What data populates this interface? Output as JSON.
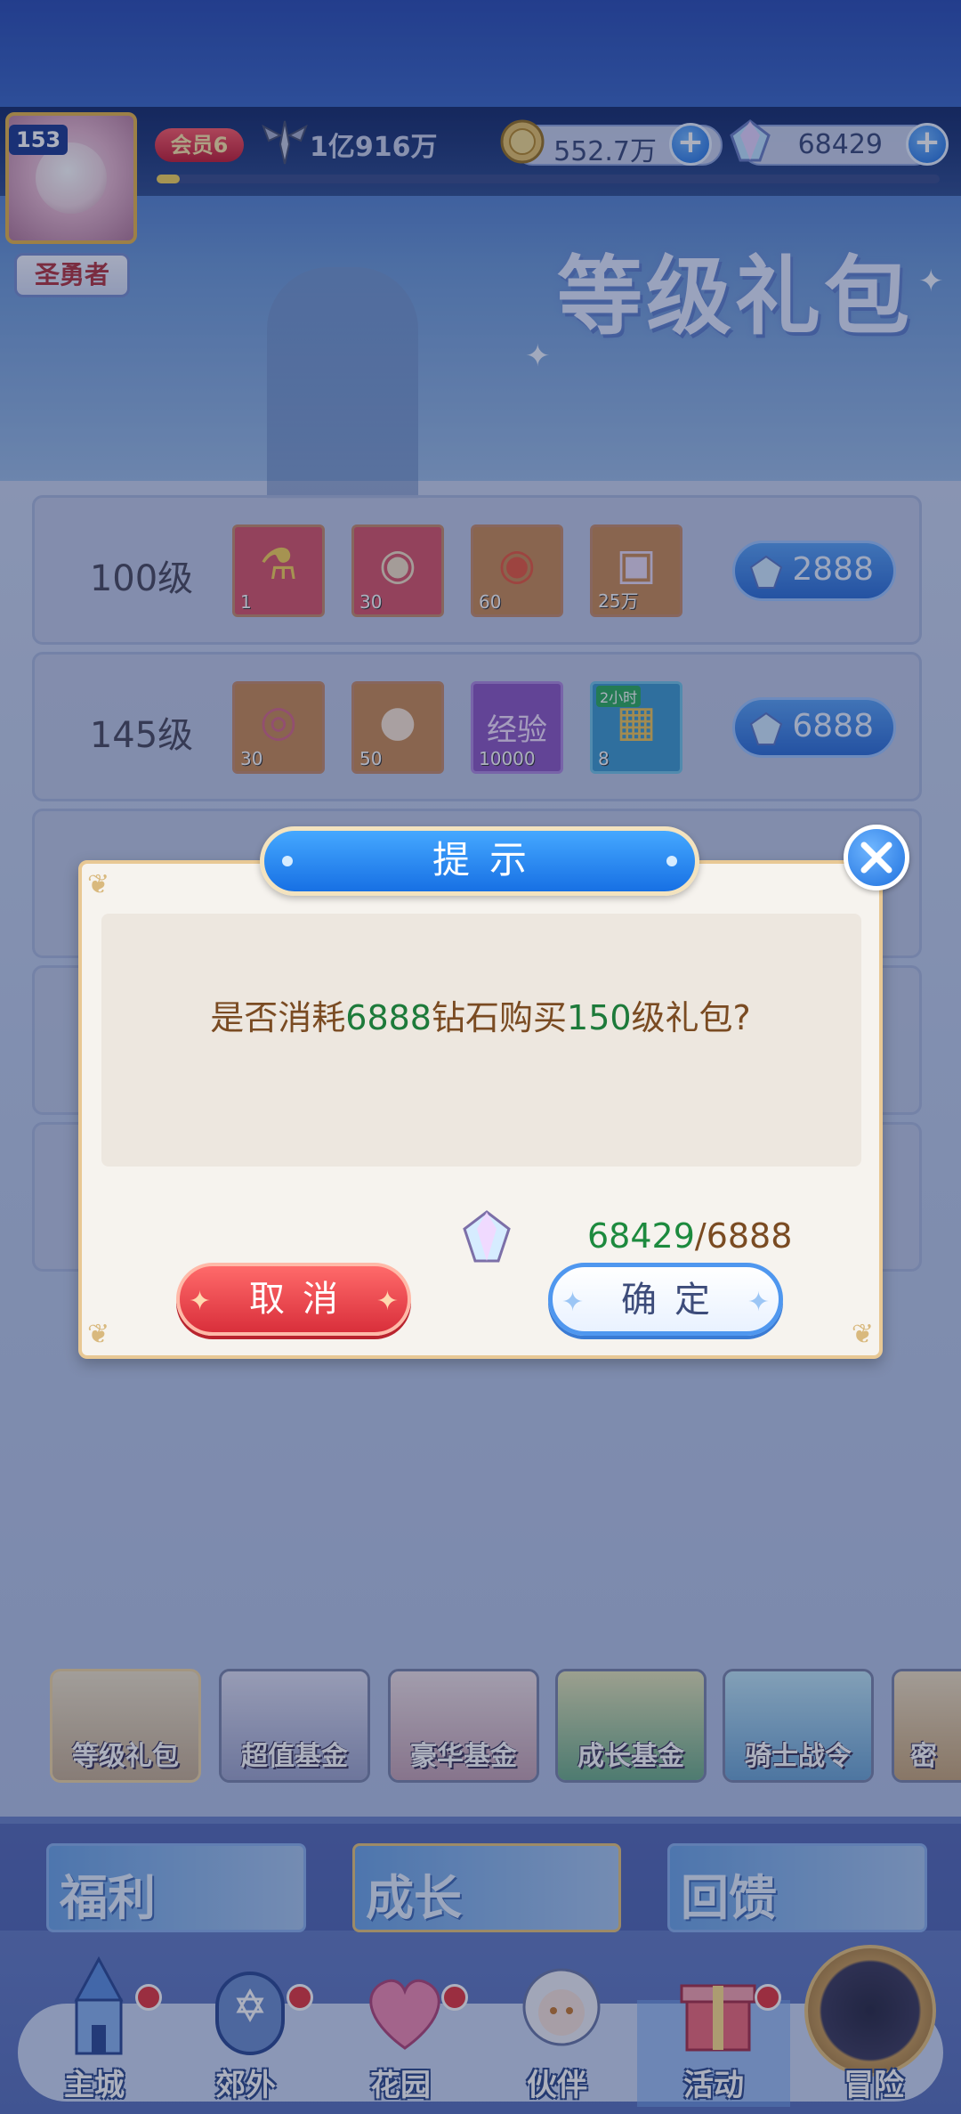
{
  "header": {
    "player_level": "153",
    "player_title": "圣勇者",
    "vip_label": "会员6",
    "power_value": "1亿916万",
    "gold_value": "552.7万",
    "diamond_value": "68429",
    "exp_progress": 0.03
  },
  "banner": {
    "title": "等级礼包"
  },
  "gift_rows": [
    {
      "level": "100级",
      "price": "2888",
      "items": [
        {
          "icon": "potion-bottle-icon",
          "qty": "1"
        },
        {
          "icon": "red-medal-icon",
          "qty": "30"
        },
        {
          "icon": "bronze-medal-icon",
          "qty": "60"
        },
        {
          "icon": "gift-card-icon",
          "qty": "25万"
        }
      ]
    },
    {
      "level": "145级",
      "price": "6888",
      "items": [
        {
          "icon": "ring-icon",
          "qty": "30"
        },
        {
          "icon": "egg-icon",
          "qty": "50"
        },
        {
          "icon": "exp-scroll-icon",
          "qty": "10000",
          "text": "经验"
        },
        {
          "icon": "treasure-chest-icon",
          "qty": "8",
          "tag": "2小时"
        }
      ]
    }
  ],
  "dialog": {
    "title": "提示",
    "message_prefix": "是否消耗",
    "message_amount": "6888",
    "message_mid": "钻石购买",
    "message_level": "150",
    "message_suffix": "级礼包?",
    "have": "68429",
    "cost": "/6888",
    "cancel_label": "取消",
    "ok_label": "确定"
  },
  "tabs": [
    {
      "label": "等级礼包",
      "active": true
    },
    {
      "label": "超值基金"
    },
    {
      "label": "豪华基金"
    },
    {
      "label": "成长基金"
    },
    {
      "label": "骑士战令"
    },
    {
      "label": "密"
    }
  ],
  "categories": [
    {
      "label": "福利"
    },
    {
      "label": "成长",
      "active": true
    },
    {
      "label": "回馈"
    }
  ],
  "nav": [
    {
      "label": "主城",
      "icon": "castle-icon",
      "badge": true
    },
    {
      "label": "郊外",
      "icon": "portal-icon",
      "badge": true
    },
    {
      "label": "花园",
      "icon": "heart-garden-icon",
      "badge": true
    },
    {
      "label": "伙伴",
      "icon": "partner-icon",
      "badge": false
    },
    {
      "label": "活动",
      "icon": "gift-box-icon",
      "badge": true,
      "active": true
    },
    {
      "label": "冒险",
      "icon": "compass-icon",
      "badge": false
    }
  ],
  "colors": {
    "accent_blue": "#1770e4",
    "cancel_red": "#d92f3b",
    "highlight_green": "#1d7a3a",
    "message_brown": "#7a4b22"
  }
}
